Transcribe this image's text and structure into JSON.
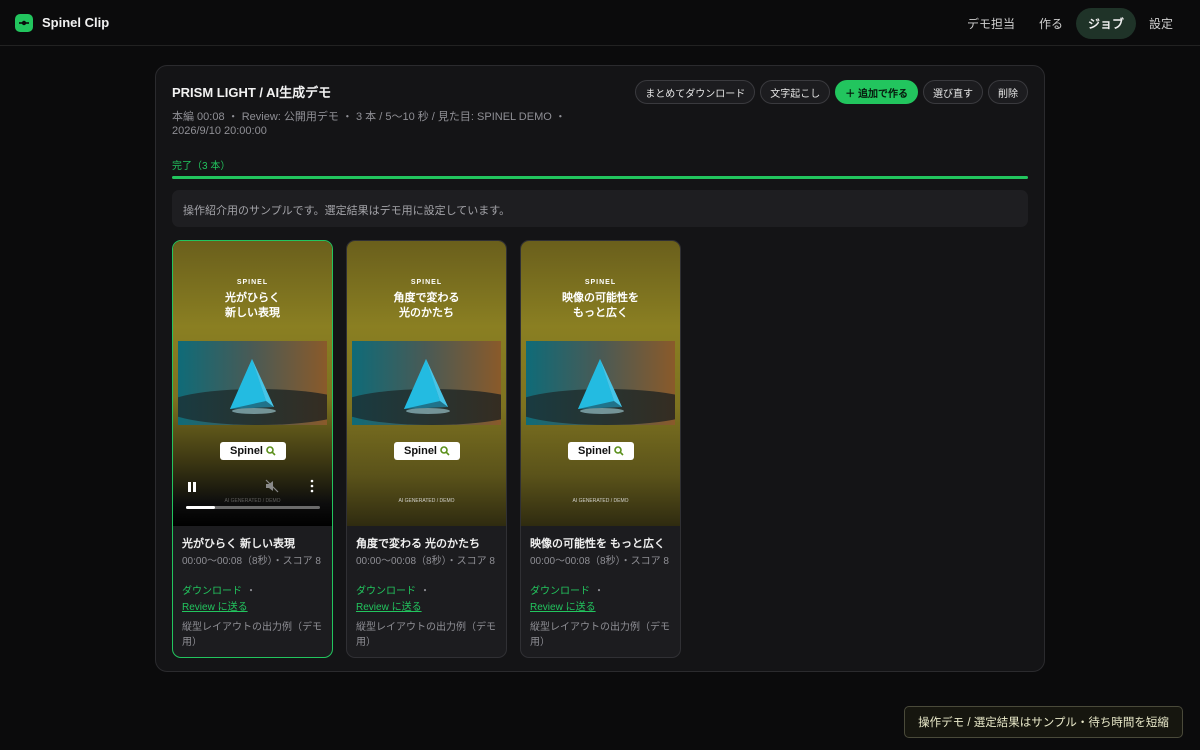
{
  "app": {
    "name": "Spinel Clip"
  },
  "nav": {
    "items": [
      {
        "label": "デモ担当",
        "active": false
      },
      {
        "label": "作る",
        "active": false
      },
      {
        "label": "ジョブ",
        "active": true
      },
      {
        "label": "設定",
        "active": false
      }
    ]
  },
  "job": {
    "title": "PRISM LIGHT / AI生成デモ",
    "meta": "本編 00:08 ・ Review: 公開用デモ ・ 3 本 / 5〜10 秒 / 見た目: SPINEL DEMO ・ 2026/9/10 20:00:00",
    "actions": {
      "download_all": "まとめてダウンロード",
      "transcribe": "文字起こし",
      "add_more": "＋ 追加で作る",
      "reselect": "選び直す",
      "delete": "削除"
    },
    "status": "完了（3 本）",
    "progress": 1.0,
    "notice": "操作紹介用のサンプルです。選定結果はデモ用に設定しています。"
  },
  "clips": [
    {
      "thumb_brand": "SPINEL",
      "thumb_headline": [
        "光がひらく",
        "新しい表現"
      ],
      "thumb_logo": "Spinel",
      "thumb_credit": "AI GENERATED / DEMO",
      "title": "光がひらく 新しい表現",
      "time": "00:00〜00:08（8秒）・スコア 8",
      "download": "ダウンロード",
      "link_sep": "・",
      "review": "Review に送る",
      "desc": "縦型レイアウトの出力例（デモ用）",
      "selected": true,
      "playing": true,
      "playback_progress": 0.22
    },
    {
      "thumb_brand": "SPINEL",
      "thumb_headline": [
        "角度で変わる",
        "光のかたち"
      ],
      "thumb_logo": "Spinel",
      "thumb_credit": "AI GENERATED / DEMO",
      "title": "角度で変わる 光のかたち",
      "time": "00:00〜00:08（8秒）・スコア 8",
      "download": "ダウンロード",
      "link_sep": "・",
      "review": "Review に送る",
      "desc": "縦型レイアウトの出力例（デモ用）",
      "selected": false,
      "playing": false
    },
    {
      "thumb_brand": "SPINEL",
      "thumb_headline": [
        "映像の可能性を",
        "もっと広く"
      ],
      "thumb_logo": "Spinel",
      "thumb_credit": "AI GENERATED / DEMO",
      "title": "映像の可能性を もっと広く",
      "time": "00:00〜00:08（8秒）・スコア 8",
      "download": "ダウンロード",
      "link_sep": "・",
      "review": "Review に送る",
      "desc": "縦型レイアウトの出力例（デモ用）",
      "selected": false,
      "playing": false
    }
  ],
  "toast": "操作デモ / 選定結果はサンプル・待ち時間を短縮",
  "colors": {
    "accent": "#22c55e",
    "background": "#0b0b0c",
    "panel": "#141416"
  },
  "icons": [
    "spinel-logo-icon",
    "plus-icon",
    "pause-icon",
    "mute-icon",
    "more-vertical-icon",
    "search-icon",
    "prism-image"
  ]
}
